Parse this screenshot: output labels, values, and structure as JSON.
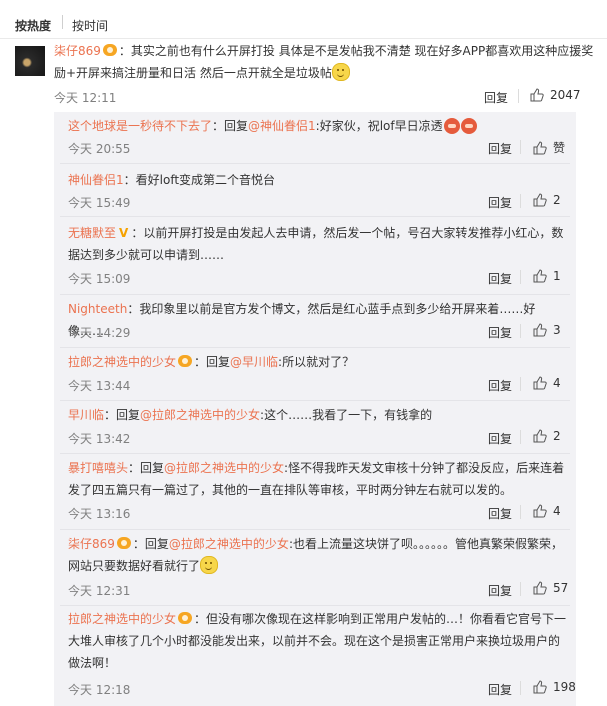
{
  "sort": {
    "hot_label": "按热度",
    "time_label": "按时间"
  },
  "main": {
    "user": "柒仔869",
    "colon": "：",
    "text": "其实之前也有什么开屏打投 具体是不是发帖我不清楚 现在好多APP都喜欢用这种应援奖励+开屏来搞注册量和日活 然后一点开就全是垃圾帖",
    "time": "今天 12:11",
    "reply_label": "回复",
    "likes": "2047"
  },
  "replies": [
    {
      "user": "这个地球是一秒待不下去了",
      "badge": "none",
      "pre": "：回复",
      "mention": "@神仙眷侣1",
      "text": ":好家伙，祝lof早日凉透",
      "emoji": "red2",
      "time": "今天 20:55",
      "reply_label": "回复",
      "likes": "赞"
    },
    {
      "user": "神仙眷侣1",
      "badge": "none",
      "pre": "：看好loft变成第二个音悦台",
      "mention": "",
      "text": "",
      "emoji": "",
      "time": "今天 15:49",
      "reply_label": "回复",
      "likes": "2"
    },
    {
      "user": "无糖默至",
      "badge": "gold",
      "pre": "：以前开屏打投是由发起人去申请，然后发一个帖，号召大家转发推荐小红心，数据达到多少就可以申请到……",
      "mention": "",
      "text": "",
      "emoji": "",
      "time": "今天 15:09",
      "reply_label": "回复",
      "likes": "1"
    },
    {
      "user": "Nighteeth",
      "badge": "none",
      "pre": "：我印象里以前是官方发个博文，然后是红心蓝手点到多少给开屏来着……好像……",
      "mention": "",
      "text": "",
      "emoji": "",
      "time": "今天 14:29",
      "reply_label": "回复",
      "likes": "3"
    },
    {
      "user": "拉郎之神选中的少女",
      "badge": "orange",
      "pre": "：回复",
      "mention": "@早川临",
      "text": ":所以就对了？",
      "emoji": "",
      "time": "今天 13:44",
      "reply_label": "回复",
      "likes": "4"
    },
    {
      "user": "早川临",
      "badge": "none",
      "pre": "：回复",
      "mention": "@拉郎之神选中的少女",
      "text": ":这个……我看了一下，有钱拿的",
      "emoji": "",
      "time": "今天 13:42",
      "reply_label": "回复",
      "likes": "2"
    },
    {
      "user": "暴打嘻嘻头",
      "badge": "none",
      "pre": "：回复",
      "mention": "@拉郎之神选中的少女",
      "text": ":怪不得我昨天发文审核十分钟了都没反应，后来连着发了四五篇只有一篇过了，其他的一直在排队等审核，平时两分钟左右就可以发的。",
      "emoji": "",
      "time": "今天 13:16",
      "reply_label": "回复",
      "likes": "4"
    },
    {
      "user": "柒仔869",
      "badge": "orange",
      "pre": "：回复",
      "mention": "@拉郎之神选中的少女",
      "text": ":也看上流量这块饼了呗。。。。。。管他真繁荣假繁荣，网站只要数据好看就行了",
      "emoji": "smile",
      "time": "今天 12:31",
      "reply_label": "回复",
      "likes": "57"
    },
    {
      "user": "拉郎之神选中的少女",
      "badge": "orange",
      "pre": "：但没有哪次像现在这样影响到正常用户发帖的…！你看看它官号下一大堆人审核了几个小时都没能发出来，以前并不会。现在这个是损害正常用户来换垃圾用户的做法啊！",
      "mention": "",
      "text": "",
      "emoji": "",
      "time": "今天 12:18",
      "reply_label": "回复",
      "likes": "198"
    }
  ]
}
